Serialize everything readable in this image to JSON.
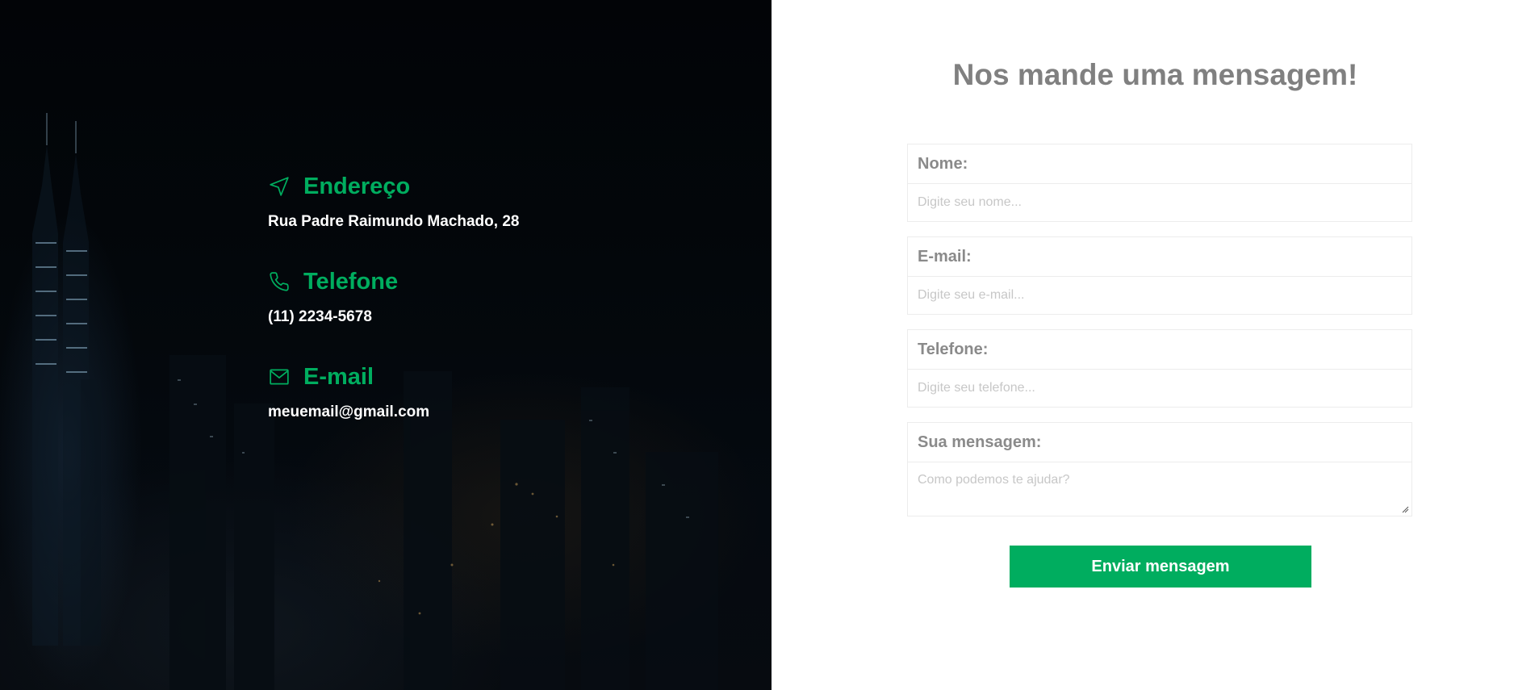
{
  "colors": {
    "accent": "#00ad5f",
    "left_background": "#020406",
    "form_text": "#808080",
    "placeholder": "#c7c7c7"
  },
  "contact": {
    "address": {
      "icon": "navigation-arrow-icon",
      "title": "Endereço",
      "value": "Rua Padre Raimundo Machado, 28"
    },
    "phone": {
      "icon": "phone-icon",
      "title": "Telefone",
      "value": "(11) 2234-5678"
    },
    "email": {
      "icon": "envelope-icon",
      "title": "E-mail",
      "value": "meuemail@gmail.com"
    }
  },
  "form": {
    "title": "Nos mande uma mensagem!",
    "name": {
      "label": "Nome:",
      "placeholder": "Digite seu nome..."
    },
    "email": {
      "label": "E-mail:",
      "placeholder": "Digite seu e-mail..."
    },
    "phone": {
      "label": "Telefone:",
      "placeholder": "Digite seu telefone..."
    },
    "message": {
      "label": "Sua mensagem:",
      "placeholder": "Como podemos te ajudar?"
    },
    "submit_label": "Enviar mensagem"
  }
}
